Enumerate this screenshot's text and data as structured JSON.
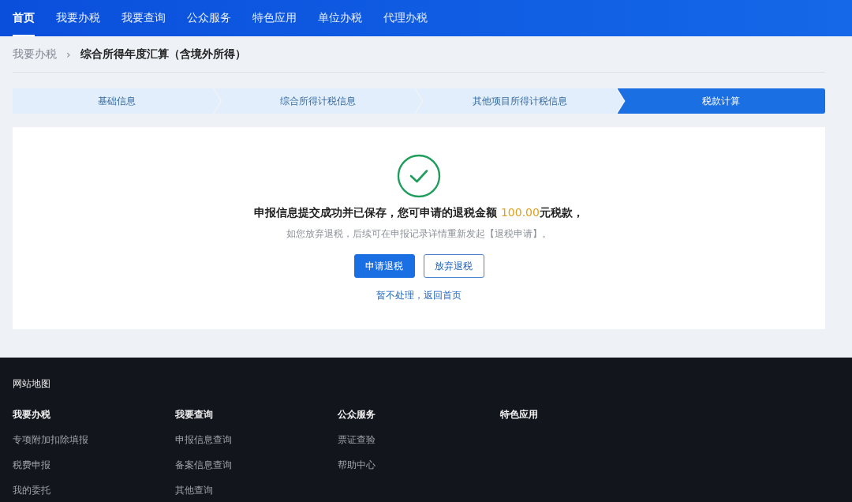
{
  "nav": [
    {
      "label": "首页",
      "selected": true
    },
    {
      "label": "我要办税",
      "selected": false
    },
    {
      "label": "我要查询",
      "selected": false
    },
    {
      "label": "公众服务",
      "selected": false
    },
    {
      "label": "特色应用",
      "selected": false
    },
    {
      "label": "单位办税",
      "selected": false
    },
    {
      "label": "代理办税",
      "selected": false
    }
  ],
  "breadcrumb": {
    "parent": "我要办税",
    "separator": "›",
    "current": "综合所得年度汇算（含境外所得）"
  },
  "steps": [
    {
      "label": "基础信息",
      "selected": false
    },
    {
      "label": "综合所得计税信息",
      "selected": false
    },
    {
      "label": "其他项目所得计税信息",
      "selected": false
    },
    {
      "label": "税款计算",
      "selected": true
    }
  ],
  "result": {
    "message_before": "申报信息提交成功并已保存，您可申请的退税金额 ",
    "amount": "100.00",
    "message_after": "元税款，",
    "hint": "如您放弃退税，后续可在申报记录详情重新发起【退税申请】。",
    "primary_button": "申请退税",
    "secondary_button": "放弃退税",
    "link": "暂不处理，返回首页"
  },
  "footer": {
    "title": "网站地图",
    "columns": [
      {
        "heading": "我要办税",
        "links": [
          "专项附加扣除填报",
          "税费申报",
          "我的委托"
        ]
      },
      {
        "heading": "我要查询",
        "links": [
          "申报信息查询",
          "备案信息查询",
          "其他查询"
        ]
      },
      {
        "heading": "公众服务",
        "links": [
          "票证查验",
          "帮助中心"
        ]
      },
      {
        "heading": "特色应用"
      }
    ]
  }
}
